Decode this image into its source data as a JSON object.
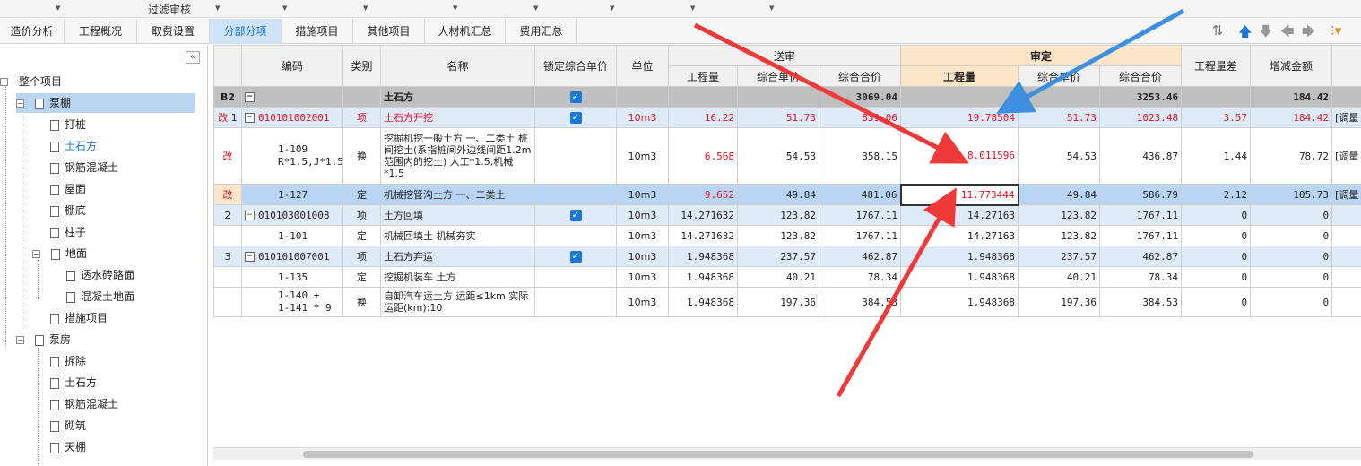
{
  "topbar": {
    "filter_label": "过滤审核"
  },
  "tabs": [
    {
      "label": "造价分析"
    },
    {
      "label": "工程概况"
    },
    {
      "label": "取费设置"
    },
    {
      "label": "分部分项"
    },
    {
      "label": "措施项目"
    },
    {
      "label": "其他项目"
    },
    {
      "label": "人材机汇总"
    },
    {
      "label": "费用汇总"
    }
  ],
  "active_tab": "分部分项",
  "tree": {
    "root": "整个项目",
    "items": [
      "泵棚",
      "打桩",
      "土石方",
      "钢筋混凝土",
      "屋面",
      "棚底",
      "柱子",
      "地面",
      "透水砖路面",
      "混凝土地面",
      "措施项目",
      "泵房",
      "拆除",
      "土石方",
      "钢筋混凝土",
      "砌筑",
      "天棚"
    ]
  },
  "headers": {
    "code": "编码",
    "type": "类别",
    "name": "名称",
    "lock": "锁定综合单价",
    "unit": "单位",
    "songshen": "送审",
    "shending": "审定",
    "qty": "工程量",
    "uprice": "综合单价",
    "total": "综合合价",
    "qty_diff": "工程量差",
    "amount_diff": "增减金额"
  },
  "rows": {
    "b2": {
      "label": "B2",
      "name": "土石方",
      "s_total": "3069.04",
      "d_total": "3253.46",
      "amt": "184.42"
    },
    "r1": {
      "mark": "改",
      "no": "1",
      "code": "010101002001",
      "type": "项",
      "name": "土石方开挖",
      "unit": "10m3",
      "s_qty": "16.22",
      "s_up": "51.73",
      "s_total": "839.06",
      "d_qty": "19.78504",
      "d_up": "51.73",
      "d_total": "1023.48",
      "qdiff": "3.57",
      "amt": "184.42",
      "note": "[调量"
    },
    "r2": {
      "mark": "改",
      "code1": "1-109",
      "code2": "R*1.5,J*1.5",
      "type": "换",
      "name": "挖掘机挖一般土方 一、二类土 桩间挖土(系指桩间外边线间距1.2m范围内的挖土) 人工*1.5,机械*1.5",
      "unit": "10m3",
      "s_qty": "6.568",
      "s_up": "54.53",
      "s_total": "358.15",
      "d_qty": "8.011596",
      "d_up": "54.53",
      "d_total": "436.87",
      "qdiff": "1.44",
      "amt": "78.72",
      "note": "[调量"
    },
    "r3": {
      "mark": "改",
      "code": "1-127",
      "type": "定",
      "name": "机械挖管沟土方 一、二类土",
      "unit": "10m3",
      "s_qty": "9.652",
      "s_up": "49.84",
      "s_total": "481.06",
      "d_qty": "11.773444",
      "d_up": "49.84",
      "d_total": "586.79",
      "qdiff": "2.12",
      "amt": "105.73",
      "note": "[调量"
    },
    "r4": {
      "no": "2",
      "code": "010103001008",
      "type": "项",
      "name": "土方回填",
      "unit": "10m3",
      "s_qty": "14.271632",
      "s_up": "123.82",
      "s_total": "1767.11",
      "d_qty": "14.27163",
      "d_up": "123.82",
      "d_total": "1767.11",
      "qdiff": "0",
      "amt": "0"
    },
    "r5": {
      "code": "1-101",
      "type": "定",
      "name": "机械回填土 机械夯实",
      "unit": "10m3",
      "s_qty": "14.271632",
      "s_up": "123.82",
      "s_total": "1767.11",
      "d_qty": "14.27163",
      "d_up": "123.82",
      "d_total": "1767.11",
      "qdiff": "0",
      "amt": "0"
    },
    "r6": {
      "no": "3",
      "code": "010101007001",
      "type": "项",
      "name": "土石方弃运",
      "unit": "10m3",
      "s_qty": "1.948368",
      "s_up": "237.57",
      "s_total": "462.87",
      "d_qty": "1.948368",
      "d_up": "237.57",
      "d_total": "462.87",
      "qdiff": "0",
      "amt": "0"
    },
    "r7": {
      "code": "1-135",
      "type": "定",
      "name": "挖掘机装车 土方",
      "unit": "10m3",
      "s_qty": "1.948368",
      "s_up": "40.21",
      "s_total": "78.34",
      "d_qty": "1.948368",
      "d_up": "40.21",
      "d_total": "78.34",
      "qdiff": "0",
      "amt": "0"
    },
    "r8": {
      "code1": "1-140 +",
      "code2": "1-141 * 9",
      "type": "换",
      "name": "自卸汽车运土方 运距≤1km 实际运距(km):10",
      "unit": "10m3",
      "s_qty": "1.948368",
      "s_up": "197.36",
      "s_total": "384.53",
      "d_qty": "1.948368",
      "d_up": "197.36",
      "d_total": "384.53",
      "qdiff": "0",
      "amt": "0"
    }
  },
  "colors": {
    "accent": "#1a78d8",
    "changed": "#e0141e",
    "annotation_red": "#f03a3a",
    "annotation_blue": "#3d8fe0"
  }
}
